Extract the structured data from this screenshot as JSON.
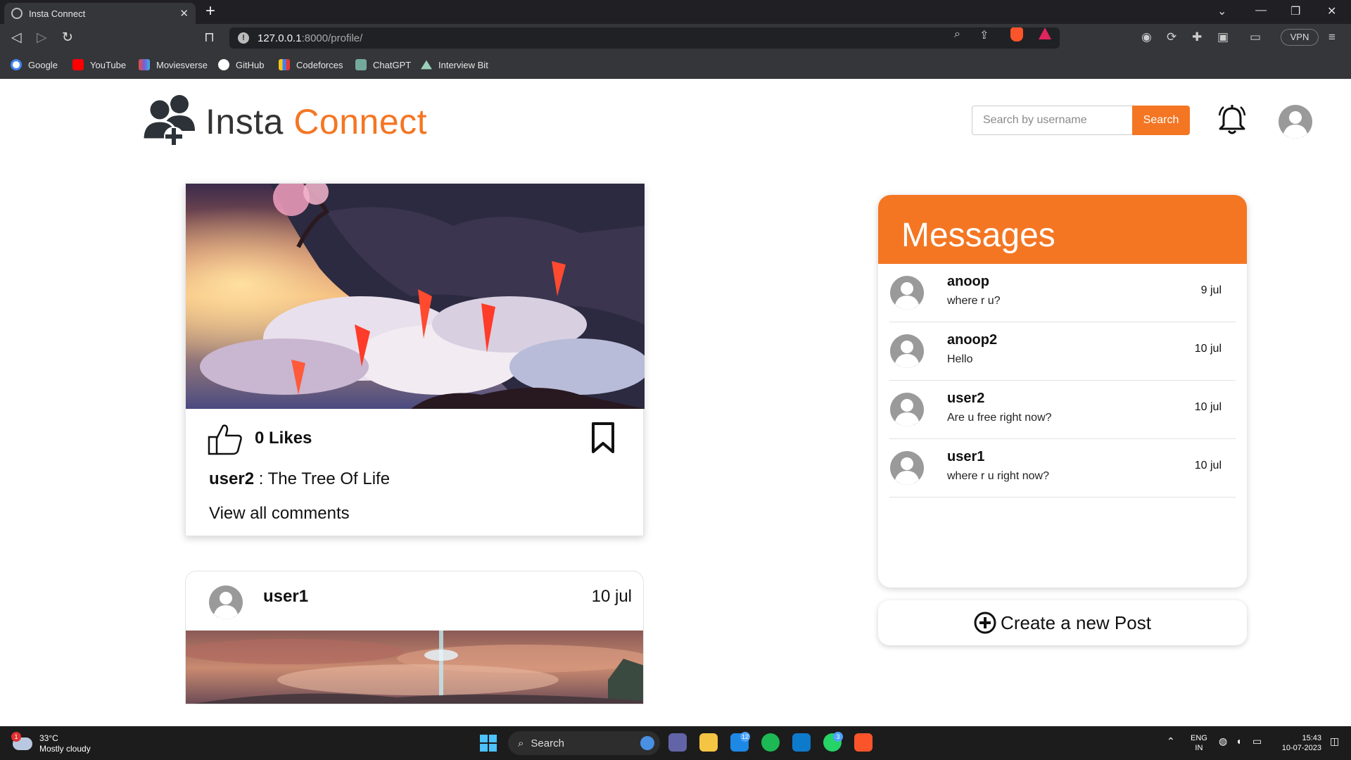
{
  "browser": {
    "tab_title": "Insta Connect",
    "url_host": "127.0.0.1",
    "url_path": ":8000/profile/",
    "vpn_label": "VPN",
    "bookmarks": [
      {
        "label": "Google",
        "color": "#4285f4"
      },
      {
        "label": "YouTube",
        "color": "#ff0000"
      },
      {
        "label": "Moviesverse",
        "color": "#7b5cd6"
      },
      {
        "label": "GitHub",
        "color": "#ffffff"
      },
      {
        "label": "Codeforces",
        "color": "#3b82f6"
      },
      {
        "label": "ChatGPT",
        "color": "#74aa9c"
      },
      {
        "label": "Interview Bit",
        "color": "#9ad0b8"
      }
    ]
  },
  "header": {
    "logo_text_1": "Insta",
    "logo_text_2": "Connect",
    "search_placeholder": "Search by username",
    "search_button": "Search"
  },
  "post1": {
    "likes": "0 Likes",
    "username": "user2",
    "caption_sep": " : ",
    "caption": "The Tree Of Life",
    "view_comments": "View all comments"
  },
  "post2": {
    "username": "user1",
    "date": "10 jul"
  },
  "messages": {
    "title": "Messages",
    "items": [
      {
        "name": "anoop",
        "text": "where r u?",
        "date": "9 jul"
      },
      {
        "name": "anoop2",
        "text": "Hello",
        "date": "10 jul"
      },
      {
        "name": "user2",
        "text": "Are u free right now?",
        "date": "10 jul"
      },
      {
        "name": "user1",
        "text": "where r u right now?",
        "date": "10 jul"
      }
    ]
  },
  "create_post": {
    "label": "Create a new Post"
  },
  "taskbar": {
    "temperature": "33°C",
    "weather": "Mostly cloudy",
    "weather_badge": "1",
    "search_label": "Search",
    "mail_badge": "12",
    "whatsapp_badge": "3",
    "lang_1": "ENG",
    "lang_2": "IN",
    "time": "15:43",
    "date": "10-07-2023"
  },
  "colors": {
    "accent": "#f47623",
    "chrome_dark": "#35363a"
  }
}
